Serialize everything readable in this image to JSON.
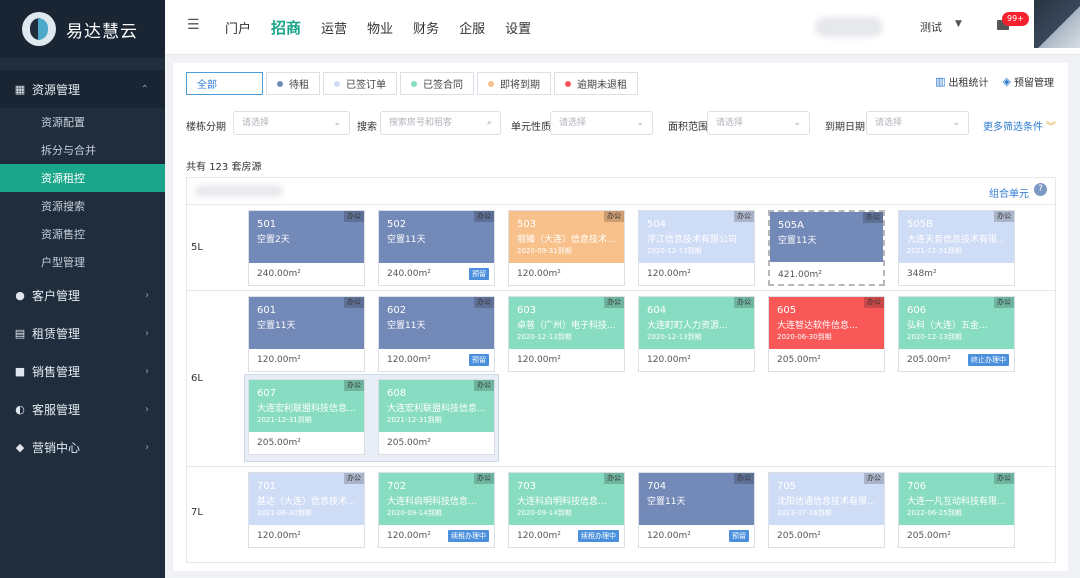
{
  "app": {
    "name": "易达慧云"
  },
  "sidebar": {
    "group_main": {
      "label": "资源管理",
      "items": [
        "资源配置",
        "拆分与合并",
        "资源租控",
        "资源搜索",
        "资源售控",
        "户型管理"
      ],
      "active_index": 2
    },
    "groups": [
      "客户管理",
      "租赁管理",
      "销售管理",
      "客服管理",
      "营销中心"
    ]
  },
  "header": {
    "tabs": [
      "门户",
      "招商",
      "运营",
      "物业",
      "财务",
      "企服",
      "设置"
    ],
    "active_tab": "招商",
    "user": "测试",
    "badge": "99+"
  },
  "status_tabs": [
    {
      "label": "全部",
      "color": ""
    },
    {
      "label": "待租",
      "color": "#7389b8"
    },
    {
      "label": "已签订单",
      "color": "#cfdcf6"
    },
    {
      "label": "已签合同",
      "color": "#88dcc1"
    },
    {
      "label": "即将到期",
      "color": "#f8c08a"
    },
    {
      "label": "逾期未退租",
      "color": "#f85858"
    }
  ],
  "actions": {
    "stats": "出租统计",
    "reserve": "预留管理"
  },
  "filters": {
    "building_label": "楼栋分期",
    "building_placeholder": "请选择",
    "search_label": "搜索",
    "search_placeholder": "搜索房号和租客",
    "nature_label": "单元性质",
    "nature_placeholder": "请选择",
    "area_label": "面积范围",
    "area_placeholder": "请选择",
    "expire_label": "到期日期",
    "expire_placeholder": "请选择",
    "more": "更多筛选条件"
  },
  "summary": {
    "prefix": "共有",
    "count": "123",
    "suffix": "套房源"
  },
  "grid": {
    "combo": "组合单元"
  },
  "floors": [
    {
      "label": "5L",
      "units": [
        {
          "no": "501",
          "status": "空置2天",
          "tag": "办公",
          "area": "240.00m²",
          "type": "vacant"
        },
        {
          "no": "502",
          "status": "空置11天",
          "tag": "办公",
          "area": "240.00m²",
          "type": "vacant",
          "btn": "预留"
        },
        {
          "no": "503",
          "status": "丽臻（大连）信息技术...",
          "exp": "2020-09-31到期",
          "tag": "办公",
          "area": "120.00m²",
          "type": "expiring"
        },
        {
          "no": "504",
          "status": "浮江信息技术有限公司",
          "exp": "2020-12-13到期",
          "tag": "办公",
          "area": "120.00m²",
          "type": "pending"
        },
        {
          "no": "505A",
          "status": "空置11天",
          "tag": "办公",
          "area": "421.00m²",
          "type": "vacant",
          "dashed": true
        },
        {
          "no": "505B",
          "status": "大连天音信息技术有限...",
          "exp": "2021-12-31到期",
          "tag": "办公",
          "area": "348m²",
          "type": "pending"
        }
      ]
    },
    {
      "label": "6L",
      "units": [
        {
          "no": "601",
          "status": "空置11天",
          "tag": "办公",
          "area": "120.00m²",
          "type": "vacant"
        },
        {
          "no": "602",
          "status": "空置11天",
          "tag": "办公",
          "area": "120.00m²",
          "type": "vacant",
          "btn": "预留"
        },
        {
          "no": "603",
          "status": "卓普（广州）电子科技...",
          "exp": "2020-12-13到期",
          "tag": "办公",
          "area": "120.00m²",
          "type": "signed"
        },
        {
          "no": "604",
          "status": "大连町町人力资源...",
          "exp": "2020-12-13到期",
          "tag": "办公",
          "area": "120.00m²",
          "type": "signed"
        },
        {
          "no": "605",
          "status": "大连智达软件信息...",
          "exp": "2020-06-30到期",
          "tag": "办公",
          "area": "205.00m²",
          "type": "overdue"
        },
        {
          "no": "606",
          "status": "弘科（大连）五金...",
          "exp": "2020-12-13到期",
          "tag": "办公",
          "area": "205.00m²",
          "type": "signed",
          "btn": "终止办理中"
        },
        {
          "no": "607",
          "status": "大连宏利联盟科技信息...",
          "exp": "2021-12-31到期",
          "tag": "办公",
          "area": "205.00m²",
          "type": "signed"
        },
        {
          "no": "608",
          "status": "大连宏利联盟科技信息...",
          "exp": "2021-12-31到期",
          "tag": "办公",
          "area": "205.00m²",
          "type": "signed"
        }
      ]
    },
    {
      "label": "7L",
      "units": [
        {
          "no": "701",
          "status": "基达（大连）信息技术...",
          "exp": "2021-06-30到期",
          "tag": "办公",
          "area": "120.00m²",
          "type": "pending"
        },
        {
          "no": "702",
          "status": "大连科启明科技信息...",
          "exp": "2020-09-14到期",
          "tag": "办公",
          "area": "120.00m²",
          "type": "signed",
          "btn": "续租办理中"
        },
        {
          "no": "703",
          "status": "大连科启明科技信息...",
          "exp": "2020-09-14到期",
          "tag": "办公",
          "area": "120.00m²",
          "type": "signed",
          "btn": "续租办理中"
        },
        {
          "no": "704",
          "status": "空置11天",
          "tag": "办公",
          "area": "120.00m²",
          "type": "vacant",
          "btn": "预留"
        },
        {
          "no": "705",
          "status": "沈阳信通信息技术有限...",
          "exp": "2023-07-16到期",
          "tag": "办公",
          "area": "205.00m²",
          "type": "pending"
        },
        {
          "no": "706",
          "status": "大连一凡互动科技有限...",
          "exp": "2022-06-25到期",
          "tag": "办公",
          "area": "205.00m²",
          "type": "signed"
        }
      ]
    }
  ]
}
